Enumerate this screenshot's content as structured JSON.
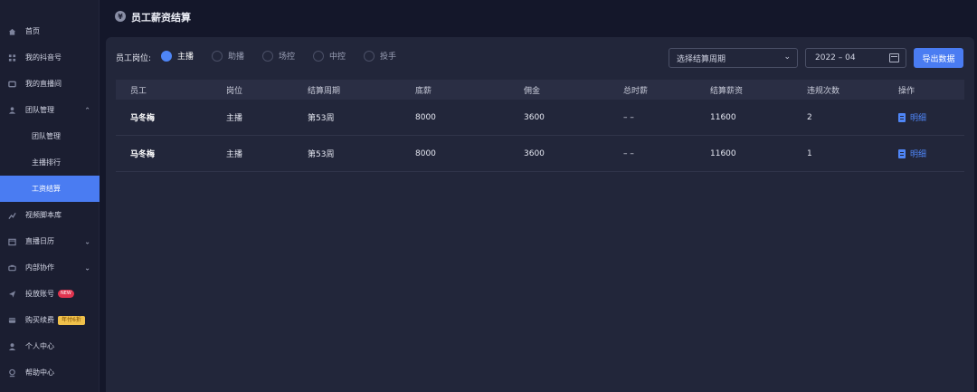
{
  "sidebar": {
    "items": [
      {
        "label": "首页",
        "icon": "home-icon"
      },
      {
        "label": "我的抖音号",
        "icon": "grid-icon"
      },
      {
        "label": "我的直播间",
        "icon": "tv-icon"
      },
      {
        "label": "团队管理",
        "icon": "team-icon",
        "expanded": true
      },
      {
        "label": "团队管理",
        "sub": true
      },
      {
        "label": "主播排行",
        "sub": true
      },
      {
        "label": "工资结算",
        "sub": true,
        "active": true
      },
      {
        "label": "视频脚本库",
        "icon": "chart-icon"
      },
      {
        "label": "直播日历",
        "icon": "calendar-icon"
      },
      {
        "label": "内部协作",
        "icon": "collab-icon"
      },
      {
        "label": "投放账号",
        "icon": "send-icon",
        "badge": "NEW"
      },
      {
        "label": "购买续费",
        "icon": "card-icon",
        "badge": "年付6折"
      },
      {
        "label": "个人中心",
        "icon": "user-icon"
      },
      {
        "label": "帮助中心",
        "icon": "help-icon"
      }
    ]
  },
  "header": {
    "icon_glyph": "¥",
    "title": "员工薪资结算"
  },
  "filters": {
    "position_label": "员工岗位:",
    "positions": [
      "主播",
      "助播",
      "场控",
      "中控",
      "投手"
    ],
    "selected_position": "主播",
    "period_placeholder": "选择结算周期",
    "month_value": "2022 – 04",
    "export_label": "导出数据"
  },
  "table": {
    "columns": [
      "员工",
      "岗位",
      "结算周期",
      "底薪",
      "佣金",
      "总时薪",
      "结算薪资",
      "违规次数",
      "操作"
    ],
    "rows": [
      {
        "name": "马冬梅",
        "position": "主播",
        "period": "第53周",
        "base": "8000",
        "commission": "3600",
        "hourly": "– –",
        "settlement": "11600",
        "violations": "2",
        "action": "明细"
      },
      {
        "name": "马冬梅",
        "position": "主播",
        "period": "第53周",
        "base": "8000",
        "commission": "3600",
        "hourly": "– –",
        "settlement": "11600",
        "violations": "1",
        "action": "明细"
      }
    ]
  },
  "colors": {
    "accent": "#4a7cf2",
    "background": "#14172a",
    "card": "#22263a",
    "sidebar": "#1b1e31"
  }
}
